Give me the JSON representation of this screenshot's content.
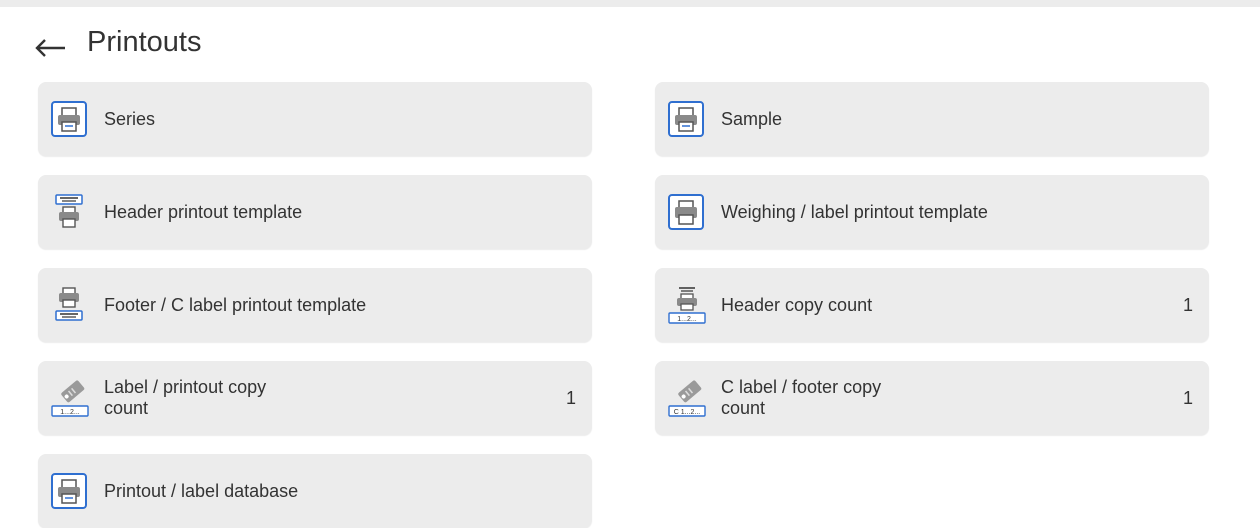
{
  "header": {
    "title": "Printouts",
    "back_icon": "arrow-left-icon"
  },
  "tiles": [
    {
      "label": "Series",
      "icon": "printer-framed-icon"
    },
    {
      "label": "Sample",
      "icon": "printer-framed-icon"
    },
    {
      "label": "Header printout template",
      "icon": "header-printer-icon"
    },
    {
      "label": "Weighing / label printout template",
      "icon": "printer-framed-icon"
    },
    {
      "label": "Footer / C label printout template",
      "icon": "footer-printer-icon"
    },
    {
      "label": "Header copy count",
      "value": "1",
      "icon": "copy-count-icon"
    },
    {
      "label": "Label / printout copy\ncount",
      "value": "1",
      "icon": "label-copy-icon"
    },
    {
      "label": "C label / footer copy\ncount",
      "value": "1",
      "icon": "c-label-copy-icon"
    },
    {
      "label": "Printout / label database",
      "icon": "printer-framed-icon"
    }
  ],
  "colors": {
    "tile_bg": "#ececec",
    "icon_blue": "#2f6fd0",
    "text": "#333333"
  }
}
